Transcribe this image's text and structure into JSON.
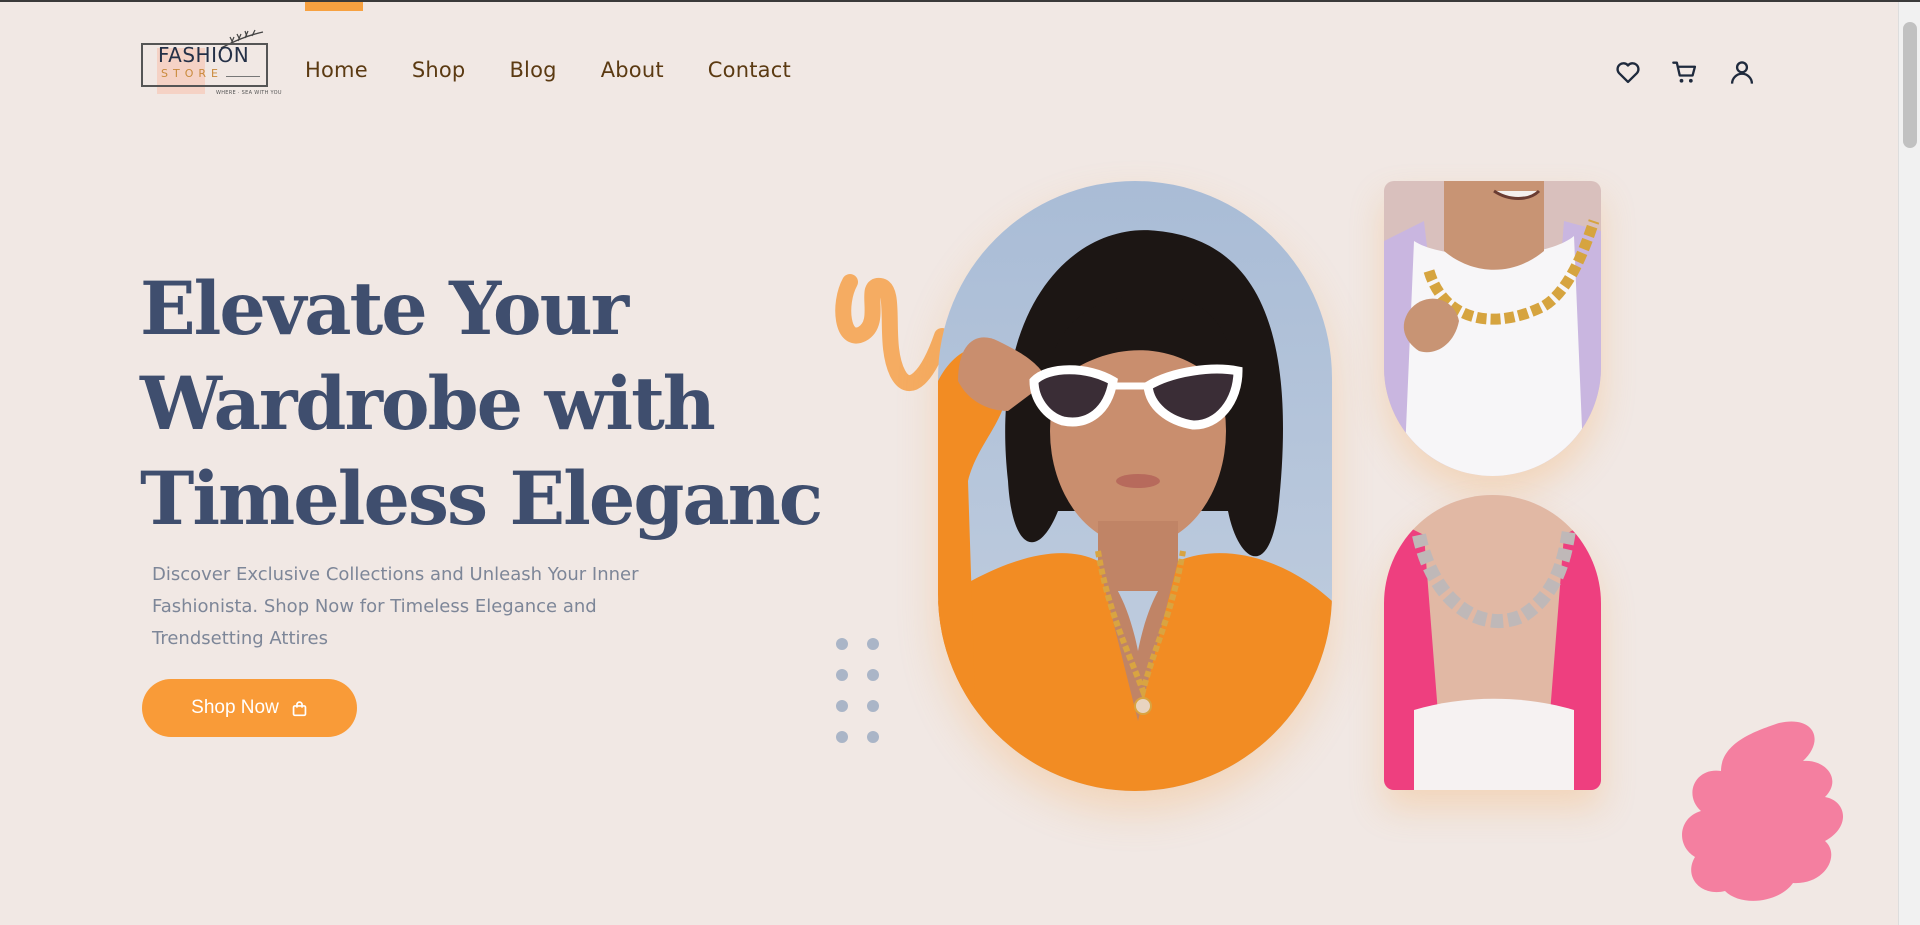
{
  "logo": {
    "title": "FASHION",
    "subtitle": "STORE",
    "tagline": "WHERE · SEA WITH YOU"
  },
  "nav": {
    "items": [
      "Home",
      "Shop",
      "Blog",
      "About",
      "Contact"
    ],
    "active": "Home"
  },
  "header_icons": [
    "heart-icon",
    "cart-icon",
    "user-icon"
  ],
  "hero": {
    "headline_lines": [
      "Elevate Your",
      "Wardrobe with",
      "Timeless Eleganc"
    ],
    "description": "Discover Exclusive Collections and Unleash Your Inner Fashionista. Shop Now for Timeless Elegance and Trendsetting Attires",
    "cta_label": "Shop Now",
    "cta_icon": "shopping-bag-icon"
  },
  "colors": {
    "background": "#f1e8e4",
    "accent": "#f99b38",
    "headline": "#3f4e6e",
    "nav_text": "#5b3a12",
    "blob": "#f47fa0"
  }
}
